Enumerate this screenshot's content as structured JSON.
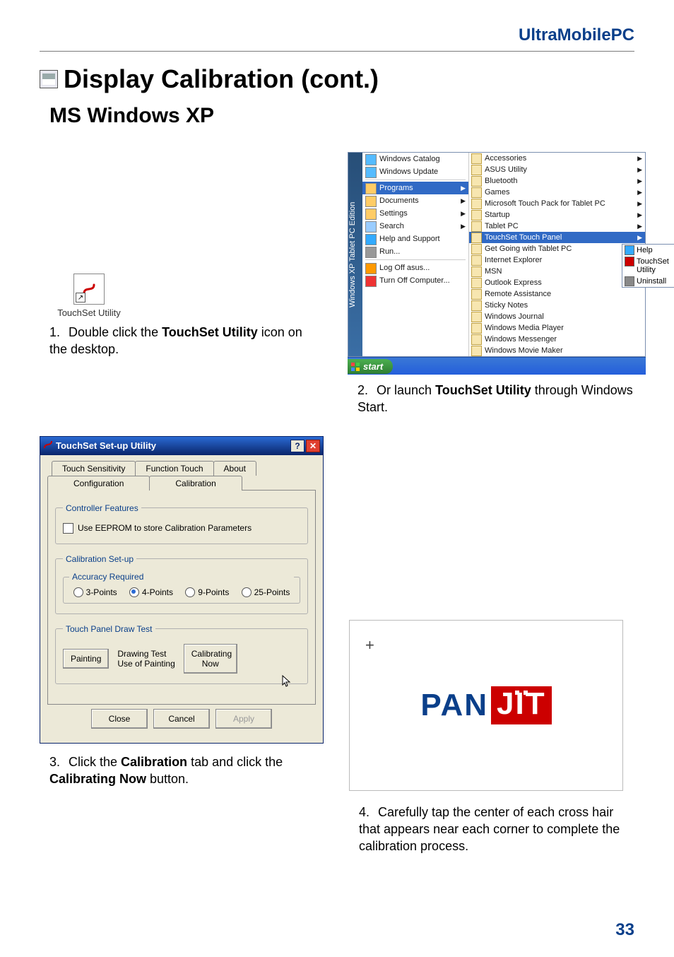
{
  "doc": {
    "header": "UltraMobilePC",
    "title": "Display Calibration (cont.)",
    "subhead": "MS Windows XP",
    "page_number": "33"
  },
  "step1": {
    "shortcut_label": "TouchSet Utility",
    "caption_num": "1.",
    "caption_pre": "Double click the ",
    "caption_bold": "TouchSet Utility",
    "caption_post": " icon on the desktop."
  },
  "step2": {
    "caption_num": "2.",
    "caption_pre": "Or launch ",
    "caption_bold": "TouchSet Utility",
    "caption_post": " through Windows Start.",
    "sidebar_label": "Windows XP Tablet PC Edition",
    "left_items": [
      "Windows Catalog",
      "Windows Update",
      "Programs",
      "Documents",
      "Settings",
      "Search",
      "Help and Support",
      "Run...",
      "Log Off asus...",
      "Turn Off Computer..."
    ],
    "left_selected_index": 2,
    "right_items": [
      "Accessories",
      "ASUS Utility",
      "Bluetooth",
      "Games",
      "Microsoft Touch Pack for Tablet PC",
      "Startup",
      "Tablet PC",
      "TouchSet Touch Panel",
      "Get Going with Tablet PC",
      "Internet Explorer",
      "MSN",
      "Outlook Express",
      "Remote Assistance",
      "Sticky Notes",
      "Windows Journal",
      "Windows Media Player",
      "Windows Messenger",
      "Windows Movie Maker"
    ],
    "right_selected_index": 7,
    "sub_items": [
      "Help",
      "TouchSet Utility",
      "Uninstall"
    ],
    "start_label": "start"
  },
  "step3": {
    "dialog_title": "TouchSet Set-up Utility",
    "tabs_upper": [
      "Touch Sensitivity",
      "Function Touch",
      "About"
    ],
    "tabs_lower": [
      "Configuration",
      "Calibration"
    ],
    "active_tab": "Calibration",
    "group_controller": "Controller Features",
    "chk_eeprom": "Use EEPROM to store Calibration Parameters",
    "group_calset": "Calibration Set-up",
    "group_accuracy": "Accuracy Required",
    "radios": [
      "3-Points",
      "4-Points",
      "9-Points",
      "25-Points"
    ],
    "radio_selected_index": 1,
    "group_drawtest": "Touch Panel Draw Test",
    "btn_painting": "Painting",
    "drawtest_line1": "Drawing Test",
    "drawtest_line2": "Use of Painting",
    "btn_calibrate": "Calibrating Now",
    "btn_close": "Close",
    "btn_cancel": "Cancel",
    "btn_apply": "Apply",
    "caption_num": "3.",
    "caption_pre": "Click the ",
    "caption_bold1": "Calibration",
    "caption_mid": " tab and click the ",
    "caption_bold2": "Calibrating Now",
    "caption_post": " button."
  },
  "step4": {
    "logo_pan": "PAN",
    "logo_jit": "JIT",
    "caption_num": "4.",
    "caption_text": "Carefully tap the center of each cross hair that appears near each corner to complete the calibration process."
  }
}
